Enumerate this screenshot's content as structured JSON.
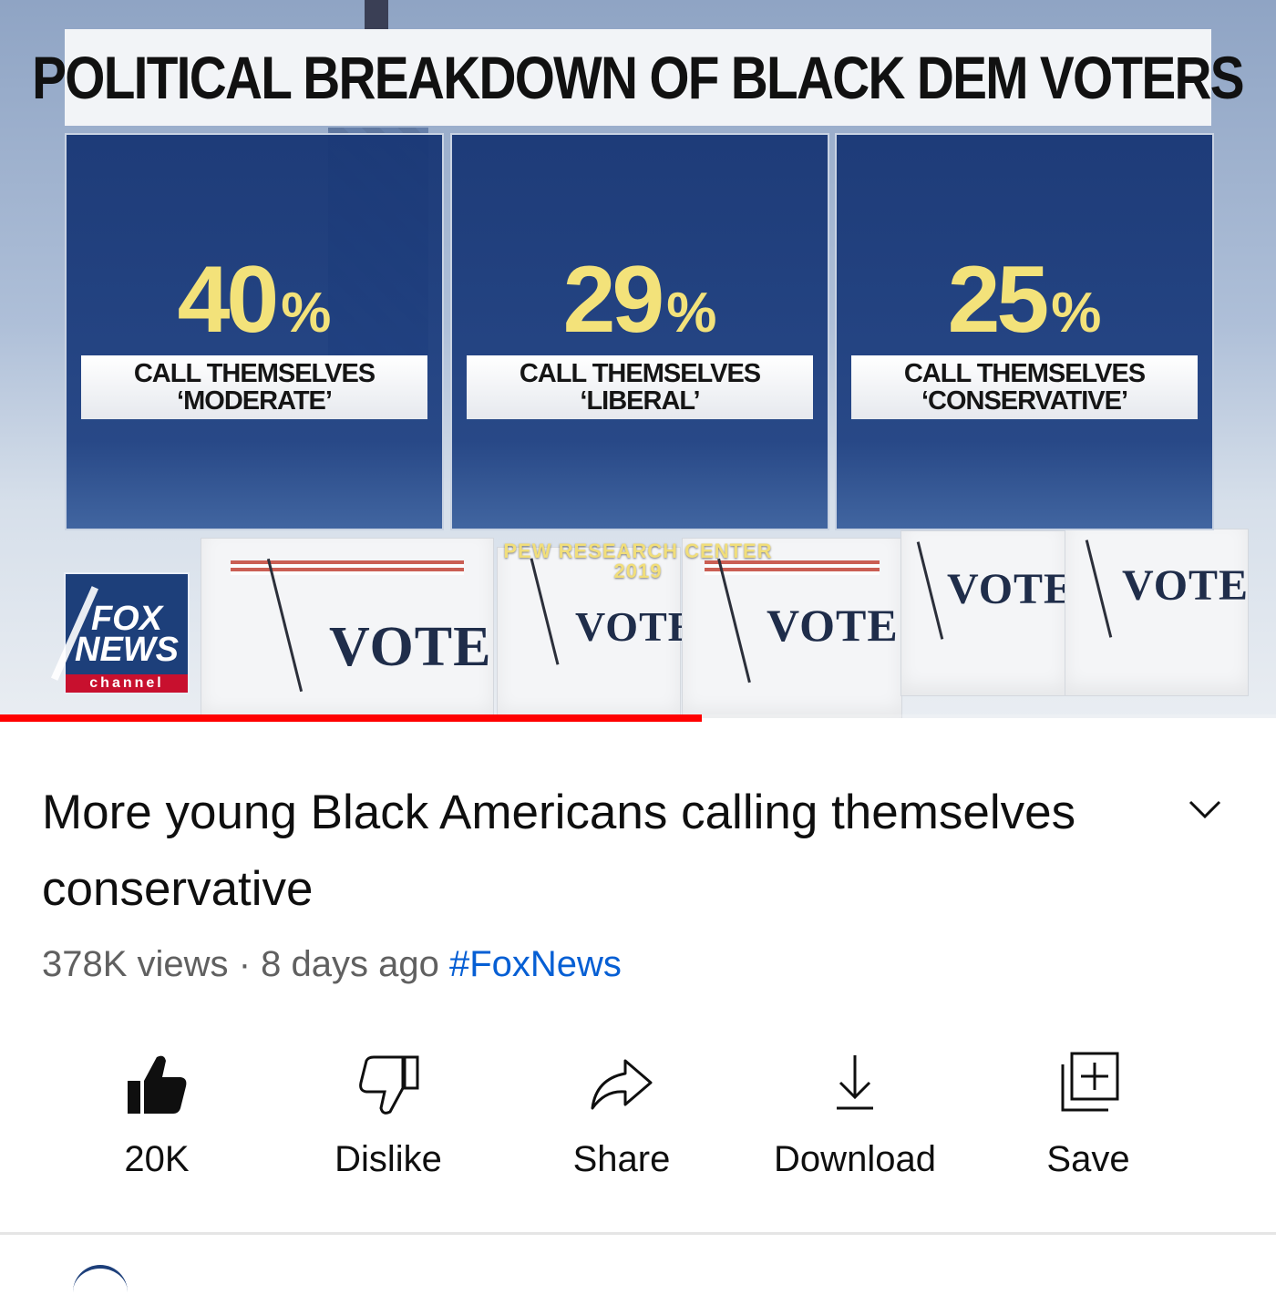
{
  "video": {
    "graphic_title": "POLITICAL BREAKDOWN OF BLACK DEM VOTERS",
    "panels": [
      {
        "value": "40",
        "unit": "%",
        "line1": "CALL THEMSELVES",
        "line2": "‘MODERATE’"
      },
      {
        "value": "29",
        "unit": "%",
        "line1": "CALL THEMSELVES",
        "line2": "‘LIBERAL’"
      },
      {
        "value": "25",
        "unit": "%",
        "line1": "CALL THEMSELVES",
        "line2": "‘CONSERVATIVE’"
      }
    ],
    "source_line1": "PEW RESEARCH CENTER",
    "source_line2": "2019",
    "ballot_text": "VOTE",
    "logo": {
      "line1": "FOX",
      "line2": "NEWS",
      "line3": "channel"
    },
    "progress_percent": 55,
    "colors": {
      "panel": "#1c3e80",
      "percent": "#f3e27a",
      "progress": "#ff0000"
    }
  },
  "info": {
    "title": "More young Black Americans calling themselves conservative",
    "views": "378K views",
    "separator": "·",
    "age": "8 days ago",
    "hashtag": "#FoxNews",
    "expand_icon": "chevron-down-icon",
    "link_color": "#065fd4"
  },
  "actions": [
    {
      "label": "20K",
      "icon": "thumbs-up-filled-icon"
    },
    {
      "label": "Dislike",
      "icon": "thumbs-down-icon"
    },
    {
      "label": "Share",
      "icon": "share-arrow-icon"
    },
    {
      "label": "Download",
      "icon": "download-icon"
    },
    {
      "label": "Save",
      "icon": "save-to-playlist-icon"
    }
  ]
}
